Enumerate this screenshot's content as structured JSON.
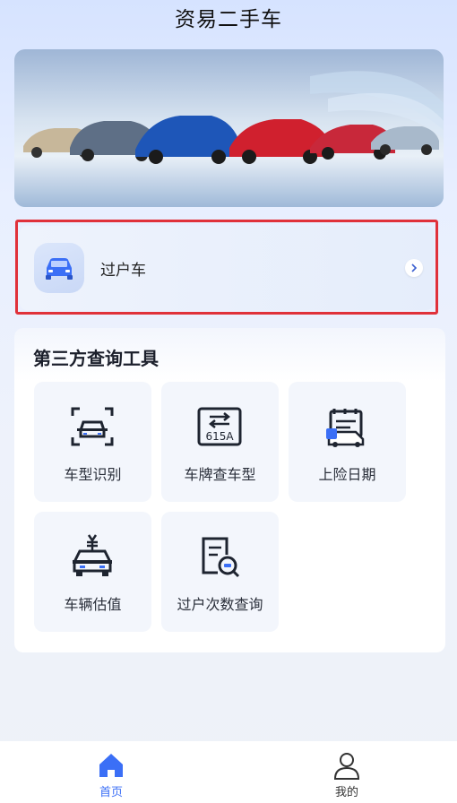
{
  "header": {
    "title": "资易二手车"
  },
  "banner": {
    "alt": "banner"
  },
  "transfer": {
    "label": "过户车",
    "icon": "car-icon",
    "arrow": "chevron-right-icon"
  },
  "tools": {
    "title": "第三方查询工具",
    "items": [
      {
        "label": "车型识别",
        "icon": "car-scan-icon"
      },
      {
        "label": "车牌查车型",
        "icon": "license-plate-icon",
        "plate_text": "615A"
      },
      {
        "label": "上险日期",
        "icon": "insurance-calendar-icon"
      },
      {
        "label": "车辆估值",
        "icon": "car-price-icon"
      },
      {
        "label": "过户次数查询",
        "icon": "document-search-icon"
      }
    ]
  },
  "nav": {
    "home": {
      "label": "首页",
      "icon": "home-icon"
    },
    "mine": {
      "label": "我的",
      "icon": "user-icon"
    }
  },
  "colors": {
    "accent": "#3b6ff6",
    "highlight": "#e0313a"
  }
}
